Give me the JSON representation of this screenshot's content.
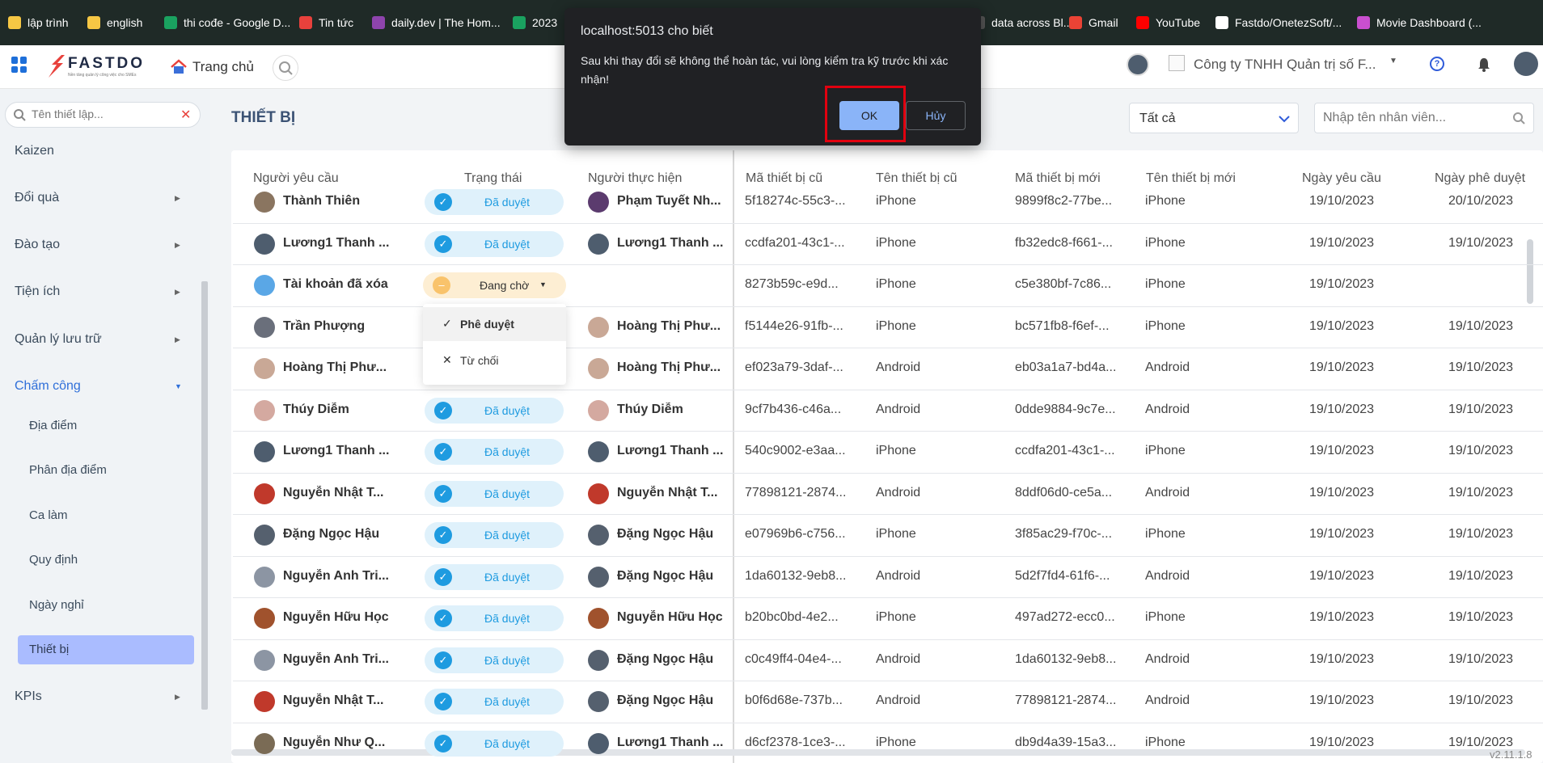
{
  "bookmarks": [
    {
      "label": "lập trình",
      "color": "#f6c744"
    },
    {
      "label": "english",
      "color": "#f6c744"
    },
    {
      "label": "thi cođe - Google D...",
      "color": "#1aa260"
    },
    {
      "label": "Tin tức",
      "color": "#e8413c"
    },
    {
      "label": "daily.dev | The Hom...",
      "color": "#8e44ad"
    },
    {
      "label": "2023",
      "color": "#1aa260"
    },
    {
      "label": "data across Bl...",
      "color": "#555555"
    },
    {
      "label": "Gmail",
      "color": "#ea4335"
    },
    {
      "label": "YouTube",
      "color": "#ff0000"
    },
    {
      "label": "Fastdo/OnetezSoft/...",
      "color": "#ffffff"
    },
    {
      "label": "Movie Dashboard (...",
      "color": "#c94fcf"
    }
  ],
  "header": {
    "logo_text": "FASTDO",
    "logo_tagline": "Nền tảng quản lý công việc cho SMEs",
    "home_label": "Trang chủ",
    "company": "Công ty TNHH Quản trị số F..."
  },
  "sidebar": {
    "search_placeholder": "Tên thiết lập...",
    "items": [
      {
        "label": "Kaizen"
      },
      {
        "label": "Đổi quà"
      },
      {
        "label": "Đào tạo"
      },
      {
        "label": "Tiện ích"
      },
      {
        "label": "Quản lý lưu trữ"
      },
      {
        "label": "Chấm công"
      },
      {
        "label": "KPIs"
      }
    ],
    "subitems": [
      {
        "label": "Địa điểm"
      },
      {
        "label": "Phân địa điểm"
      },
      {
        "label": "Ca làm"
      },
      {
        "label": "Quy định"
      },
      {
        "label": "Ngày nghỉ"
      },
      {
        "label": "Thiết bị"
      }
    ]
  },
  "page": {
    "title": "THIẾT BỊ",
    "filter_value": "Tất cả",
    "employee_placeholder": "Nhập tên nhân viên...",
    "version": "v2.11.1.8"
  },
  "table": {
    "columns": [
      "Người yêu cầu",
      "Trạng thái",
      "Người thực hiện",
      "Mã thiết bị cũ",
      "Tên thiết bị cũ",
      "Mã thiết bị mới",
      "Tên thiết bị mới",
      "Ngày yêu cầu",
      "Ngày phê duyệt"
    ],
    "rows": [
      {
        "req": "Thành Thiên",
        "status": "Đã duyệt",
        "exec": "Phạm Tuyết Nh...",
        "old_id": "5f18274c-55c3-...",
        "old_name": "iPhone",
        "new_id": "9899f8c2-77be...",
        "new_name": "iPhone",
        "req_date": "19/10/2023",
        "appr_date": "20/10/2023",
        "c1": "#8a7560",
        "c2": "#5b3b6e"
      },
      {
        "req": "Lương1 Thanh ...",
        "status": "Đã duyệt",
        "exec": "Lương1 Thanh ...",
        "old_id": "ccdfa201-43c1-...",
        "old_name": "iPhone",
        "new_id": "fb32edc8-f661-...",
        "new_name": "iPhone",
        "req_date": "19/10/2023",
        "appr_date": "19/10/2023",
        "c1": "#4e5d6e",
        "c2": "#4e5d6e"
      },
      {
        "req": "Tài khoản đã xóa",
        "status": "Đang chờ",
        "exec": "",
        "old_id": "8273b59c-e9d...",
        "old_name": "iPhone",
        "new_id": "c5e380bf-7c86...",
        "new_name": "iPhone",
        "req_date": "19/10/2023",
        "appr_date": "",
        "c1": "#5aa7e6",
        "c2": ""
      },
      {
        "req": "Trần Phượng",
        "status": "",
        "exec": "Hoàng Thị Phư...",
        "old_id": "f5144e26-91fb-...",
        "old_name": "iPhone",
        "new_id": "bc571fb8-f6ef-...",
        "new_name": "iPhone",
        "req_date": "19/10/2023",
        "appr_date": "19/10/2023",
        "c1": "#6a6f7b",
        "c2": "#c9a896"
      },
      {
        "req": "Hoàng Thị Phư...",
        "status": "",
        "exec": "Hoàng Thị Phư...",
        "old_id": "ef023a79-3daf-...",
        "old_name": "Android",
        "new_id": "eb03a1a7-bd4a...",
        "new_name": "Android",
        "req_date": "19/10/2023",
        "appr_date": "19/10/2023",
        "c1": "#c9a896",
        "c2": "#c9a896"
      },
      {
        "req": "Thúy Diễm",
        "status": "Đã duyệt",
        "exec": "Thúy Diễm",
        "old_id": "9cf7b436-c46a...",
        "old_name": "Android",
        "new_id": "0dde9884-9c7e...",
        "new_name": "Android",
        "req_date": "19/10/2023",
        "appr_date": "19/10/2023",
        "c1": "#d4a9a0",
        "c2": "#d4a9a0"
      },
      {
        "req": "Lương1 Thanh ...",
        "status": "Đã duyệt",
        "exec": "Lương1 Thanh ...",
        "old_id": "540c9002-e3aa...",
        "old_name": "iPhone",
        "new_id": "ccdfa201-43c1-...",
        "new_name": "iPhone",
        "req_date": "19/10/2023",
        "appr_date": "19/10/2023",
        "c1": "#4e5d6e",
        "c2": "#4e5d6e"
      },
      {
        "req": "Nguyễn Nhật T...",
        "status": "Đã duyệt",
        "exec": "Nguyễn Nhật T...",
        "old_id": "77898121-2874...",
        "old_name": "Android",
        "new_id": "8ddf06d0-ce5a...",
        "new_name": "Android",
        "req_date": "19/10/2023",
        "appr_date": "19/10/2023",
        "c1": "#c0392b",
        "c2": "#c0392b"
      },
      {
        "req": "Đặng Ngọc Hậu",
        "status": "Đã duyệt",
        "exec": "Đặng Ngọc Hậu",
        "old_id": "e07969b6-c756...",
        "old_name": "iPhone",
        "new_id": "3f85ac29-f70c-...",
        "new_name": "iPhone",
        "req_date": "19/10/2023",
        "appr_date": "19/10/2023",
        "c1": "#55606e",
        "c2": "#55606e"
      },
      {
        "req": "Nguyễn Anh Tri...",
        "status": "Đã duyệt",
        "exec": "Đặng Ngọc Hậu",
        "old_id": "1da60132-9eb8...",
        "old_name": "Android",
        "new_id": "5d2f7fd4-61f6-...",
        "new_name": "Android",
        "req_date": "19/10/2023",
        "appr_date": "19/10/2023",
        "c1": "#8c95a3",
        "c2": "#55606e"
      },
      {
        "req": "Nguyễn Hữu Học",
        "status": "Đã duyệt",
        "exec": "Nguyễn Hữu Học",
        "old_id": "b20bc0bd-4e2...",
        "old_name": "iPhone",
        "new_id": "497ad272-ecc0...",
        "new_name": "iPhone",
        "req_date": "19/10/2023",
        "appr_date": "19/10/2023",
        "c1": "#a0522d",
        "c2": "#a0522d"
      },
      {
        "req": "Nguyễn Anh Tri...",
        "status": "Đã duyệt",
        "exec": "Đặng Ngọc Hậu",
        "old_id": "c0c49ff4-04e4-...",
        "old_name": "Android",
        "new_id": "1da60132-9eb8...",
        "new_name": "Android",
        "req_date": "19/10/2023",
        "appr_date": "19/10/2023",
        "c1": "#8c95a3",
        "c2": "#55606e"
      },
      {
        "req": "Nguyễn Nhật T...",
        "status": "Đã duyệt",
        "exec": "Đặng Ngọc Hậu",
        "old_id": "b0f6d68e-737b...",
        "old_name": "Android",
        "new_id": "77898121-2874...",
        "new_name": "Android",
        "req_date": "19/10/2023",
        "appr_date": "19/10/2023",
        "c1": "#c0392b",
        "c2": "#55606e"
      },
      {
        "req": "Nguyễn Như Q...",
        "status": "Đã duyệt",
        "exec": "Lương1 Thanh ...",
        "old_id": "d6cf2378-1ce3-...",
        "old_name": "iPhone",
        "new_id": "db9d4a39-15a3...",
        "new_name": "iPhone",
        "req_date": "19/10/2023",
        "appr_date": "19/10/2023",
        "c1": "#7a6b55",
        "c2": "#4e5d6e"
      }
    ]
  },
  "status_dropdown": {
    "approve": "Phê duyệt",
    "reject": "Từ chối"
  },
  "dialog": {
    "title": "localhost:5013 cho biết",
    "message": "Sau khi thay đổi sẽ không thể hoàn tác, vui lòng kiểm tra kỹ trước khi xác nhận!",
    "ok": "OK",
    "cancel": "Hủy"
  },
  "colors": {
    "accent": "#1e9be0",
    "active_menu": "#aabcff",
    "ok_button": "#8ab4f8",
    "highlight_box": "#e1000f"
  }
}
